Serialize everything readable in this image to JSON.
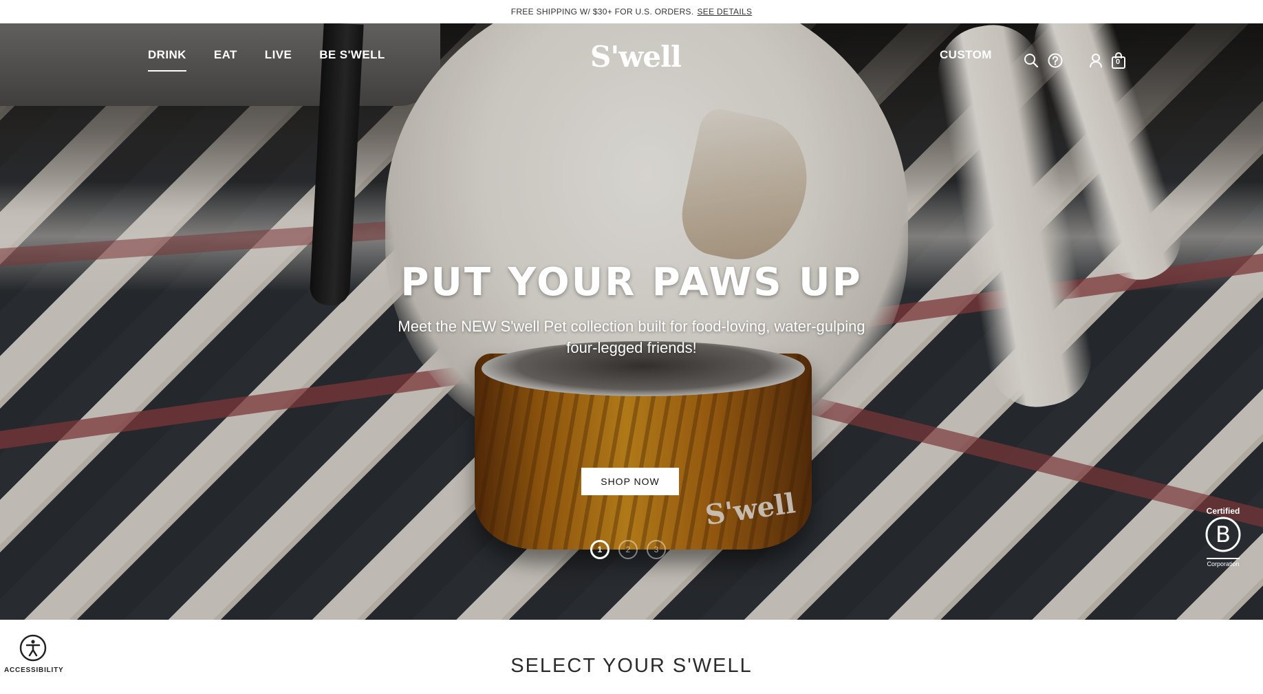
{
  "announcement": {
    "text": "FREE SHIPPING W/ $30+ FOR U.S. ORDERS.",
    "link": "SEE DETAILS"
  },
  "nav": {
    "left": [
      "DRINK",
      "EAT",
      "LIVE",
      "BE S'WELL"
    ],
    "active": "DRINK",
    "logo": "S'well",
    "custom": "CUSTOM",
    "cart_count": "0",
    "icons": [
      "search-icon",
      "help-icon",
      "account-icon",
      "cart-icon"
    ]
  },
  "hero": {
    "title": "PUT YOUR PAWS UP",
    "subtitle": "Meet the NEW S'well Pet collection built for food-loving, water-gulping four-legged friends!",
    "cta": "SHOP NOW",
    "bowl_logo": "S'well",
    "slides": [
      "1",
      "2",
      "3"
    ],
    "active_slide": "1"
  },
  "badge": {
    "top": "Certified",
    "bottom": "Corporation"
  },
  "accessibility": {
    "label": "ACCESSIBILITY"
  },
  "section": {
    "title": "SELECT YOUR S'WELL"
  }
}
